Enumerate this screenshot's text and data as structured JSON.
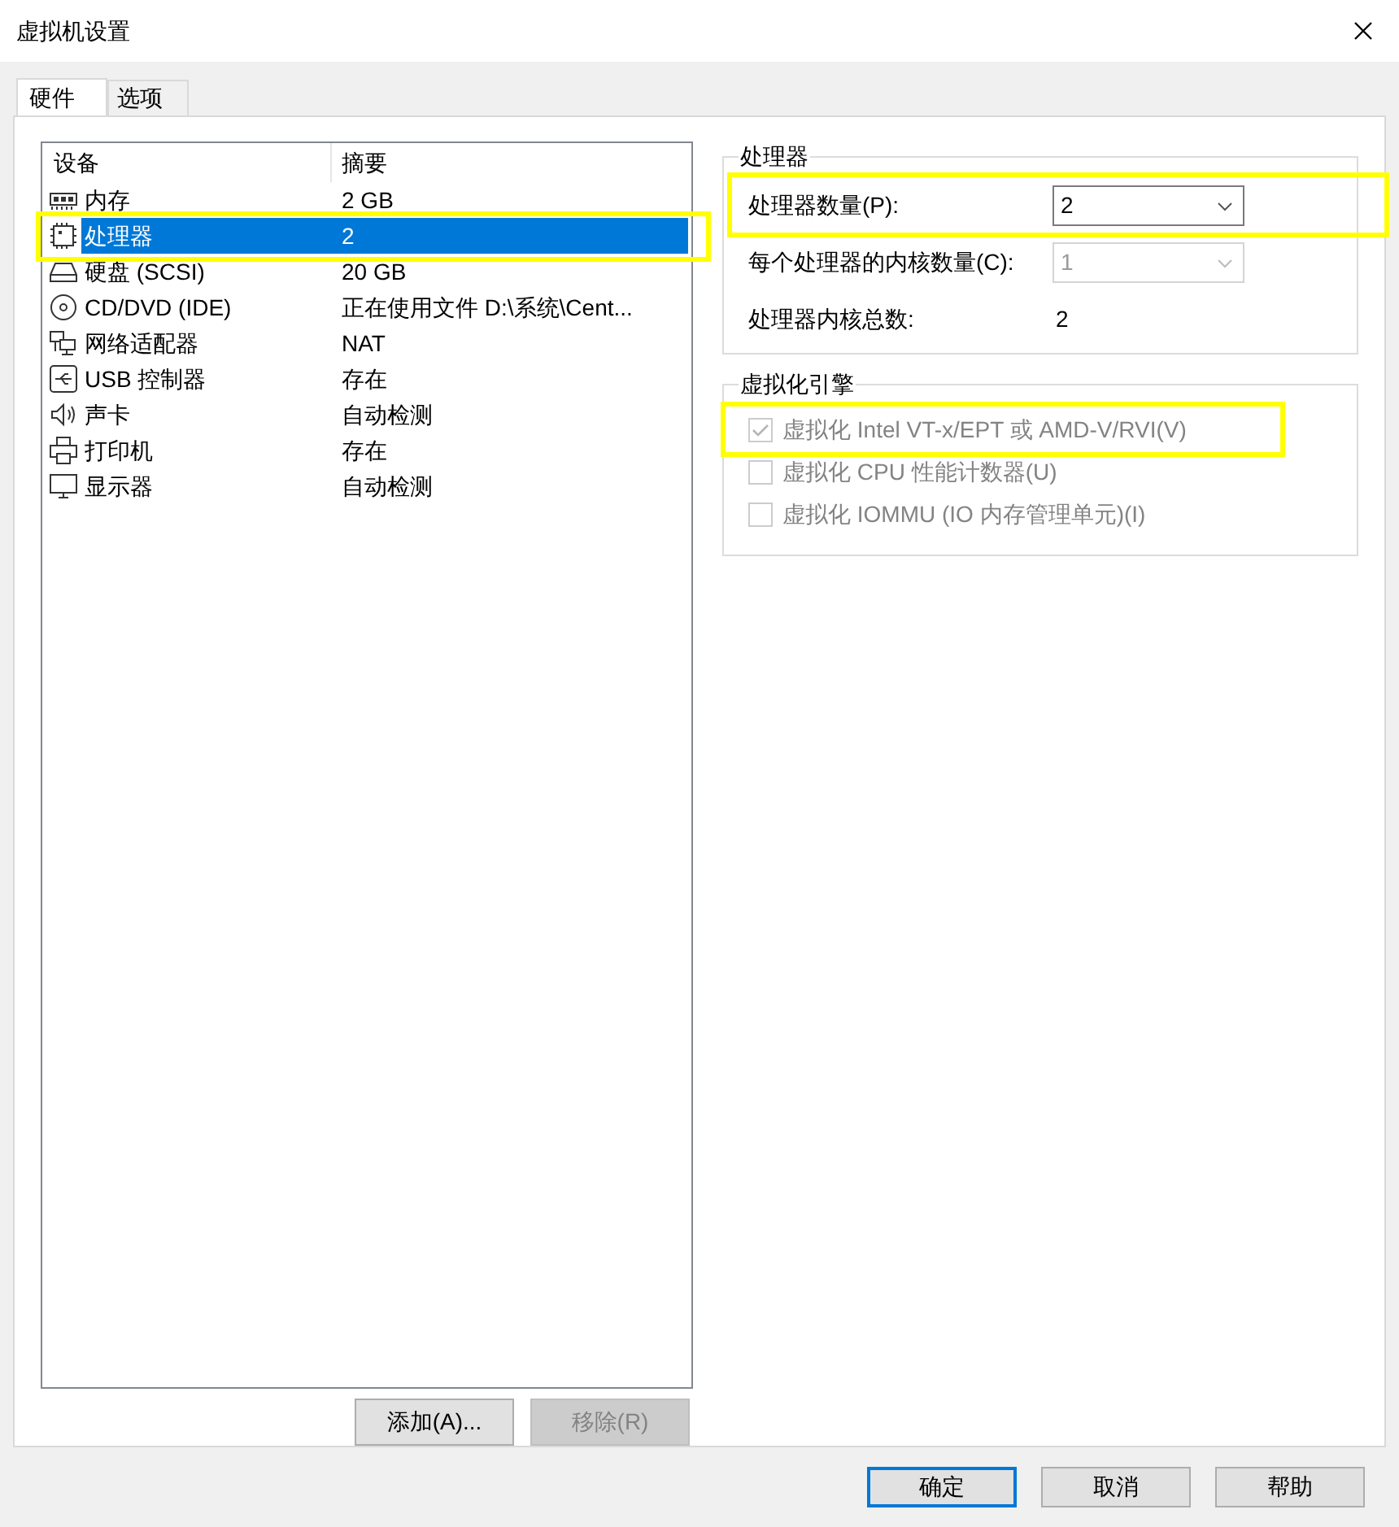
{
  "window": {
    "title": "虚拟机设置"
  },
  "tabs": [
    {
      "label": "硬件",
      "selected": true
    },
    {
      "label": "选项",
      "selected": false
    }
  ],
  "device_list": {
    "columns": [
      "设备",
      "摘要"
    ],
    "rows": [
      {
        "kind": "memory",
        "device": "内存",
        "summary": "2 GB",
        "selected": false,
        "highlighted": false
      },
      {
        "kind": "cpu",
        "device": "处理器",
        "summary": "2",
        "selected": true,
        "highlighted": true
      },
      {
        "kind": "disk",
        "device": "硬盘 (SCSI)",
        "summary": "20 GB",
        "selected": false,
        "highlighted": false
      },
      {
        "kind": "cd",
        "device": "CD/DVD (IDE)",
        "summary": "正在使用文件 D:\\系统\\Cent...",
        "selected": false,
        "highlighted": false
      },
      {
        "kind": "network",
        "device": "网络适配器",
        "summary": "NAT",
        "selected": false,
        "highlighted": false
      },
      {
        "kind": "usb",
        "device": "USB 控制器",
        "summary": "存在",
        "selected": false,
        "highlighted": false
      },
      {
        "kind": "sound",
        "device": "声卡",
        "summary": "自动检测",
        "selected": false,
        "highlighted": false
      },
      {
        "kind": "printer",
        "device": "打印机",
        "summary": "存在",
        "selected": false,
        "highlighted": false
      },
      {
        "kind": "display",
        "device": "显示器",
        "summary": "自动检测",
        "selected": false,
        "highlighted": false
      }
    ]
  },
  "list_buttons": [
    {
      "label": "添加(A)...",
      "disabled": false
    },
    {
      "label": "移除(R)",
      "disabled": true
    }
  ],
  "processor_group": {
    "title": "处理器",
    "fields": [
      {
        "kind": "combo",
        "label": "处理器数量(P):",
        "value": "2",
        "disabled": false,
        "highlighted": true
      },
      {
        "kind": "combo",
        "label": "每个处理器的内核数量(C):",
        "value": "1",
        "disabled": true,
        "highlighted": false
      },
      {
        "kind": "text",
        "label": "处理器内核总数:",
        "value": "2"
      }
    ]
  },
  "virtualization_group": {
    "title": "虚拟化引擎",
    "options": [
      {
        "label": "虚拟化 Intel VT-x/EPT 或 AMD-V/RVI(V)",
        "checked": true,
        "disabled": true,
        "highlighted": true
      },
      {
        "label": "虚拟化 CPU 性能计数器(U)",
        "checked": false,
        "disabled": true,
        "highlighted": false
      },
      {
        "label": "虚拟化 IOMMU (IO 内存管理单元)(I)",
        "checked": false,
        "disabled": true,
        "highlighted": false
      }
    ]
  },
  "dialog_buttons": [
    {
      "label": "确定",
      "default": true
    },
    {
      "label": "取消",
      "default": false
    },
    {
      "label": "帮助",
      "default": false
    }
  ]
}
